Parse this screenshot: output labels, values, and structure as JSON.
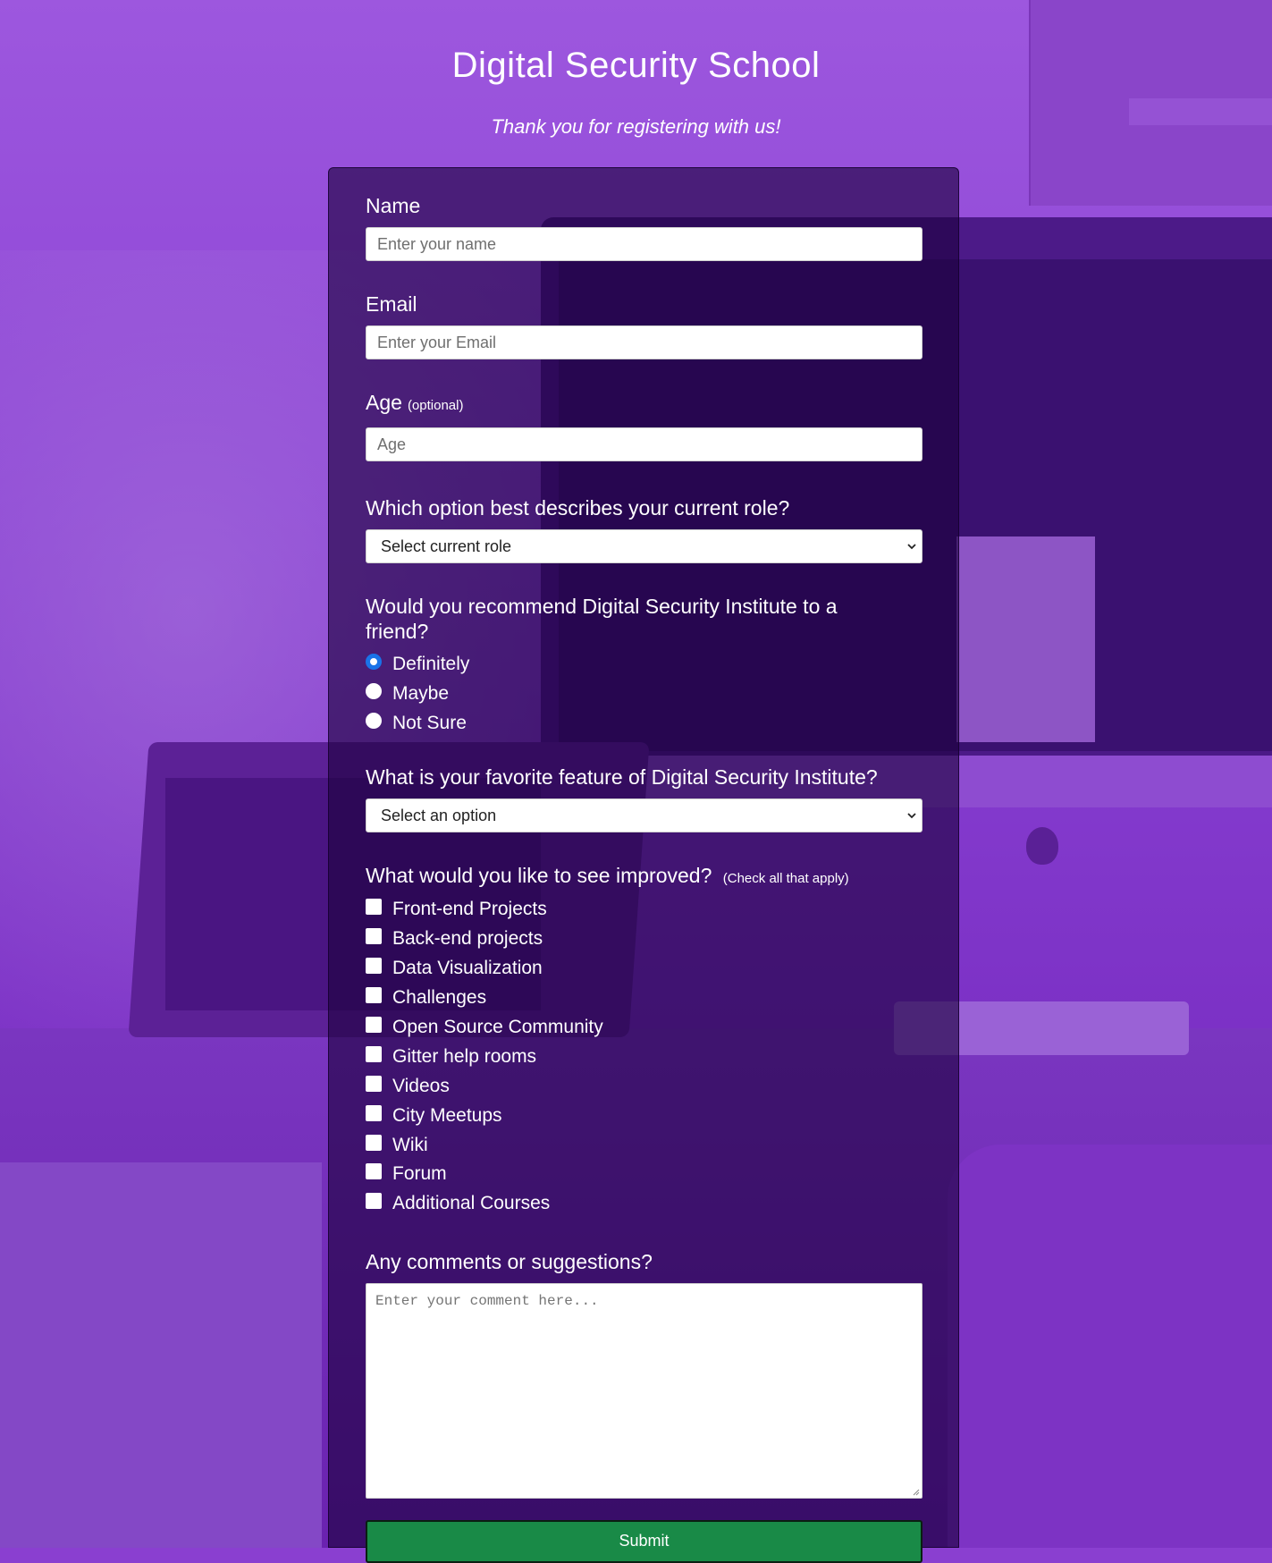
{
  "header": {
    "title": "Digital Security School",
    "subtitle": "Thank you for registering with us!"
  },
  "form": {
    "name": {
      "label": "Name",
      "placeholder": "Enter your name",
      "value": ""
    },
    "email": {
      "label": "Email",
      "placeholder": "Enter your Email",
      "value": ""
    },
    "age": {
      "label": "Age",
      "hint": "(optional)",
      "placeholder": "Age",
      "value": ""
    },
    "role": {
      "question": "Which option best describes your current role?",
      "selected": "Select current role"
    },
    "recommend": {
      "question": "Would you recommend Digital Security Institute to a friend?",
      "options": [
        {
          "label": "Definitely",
          "checked": true
        },
        {
          "label": "Maybe",
          "checked": false
        },
        {
          "label": "Not Sure",
          "checked": false
        }
      ]
    },
    "feature": {
      "question": "What is your favorite feature of Digital Security Institute?",
      "selected": "Select an option"
    },
    "improve": {
      "question": "What would you like to see improved?",
      "hint": "(Check all that apply)",
      "options": [
        "Front-end Projects",
        "Back-end projects",
        "Data Visualization",
        "Challenges",
        "Open Source Community",
        "Gitter help rooms",
        "Videos",
        "City Meetups",
        "Wiki",
        "Forum",
        "Additional Courses"
      ]
    },
    "comments": {
      "question": "Any comments or suggestions?",
      "placeholder": "Enter your comment here..."
    },
    "submit_label": "Submit"
  },
  "colors": {
    "background": "#8a3fd0",
    "card": "#1b003e",
    "submit": "#198a47",
    "radio_checked": "#1a73e8"
  },
  "icons": {
    "select_chevron": "chevron-down-icon",
    "textarea_resize": "resize-grip-icon"
  }
}
